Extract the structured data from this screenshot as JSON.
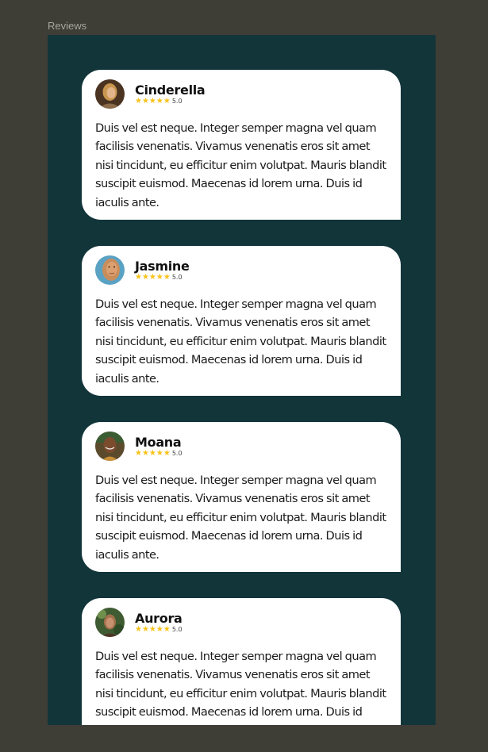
{
  "frame": {
    "label": "Reviews"
  },
  "reviews": [
    {
      "name": "Cinderella",
      "stars": "★★★★★",
      "rating": "5.0",
      "text": "Duis vel est neque. Integer semper magna vel quam facilisis venenatis. Vivamus venenatis eros sit amet nisi tincidunt, eu efficitur enim volutpat. Mauris blandit suscipit euismod. Maecenas id lorem urna. Duis id iaculis ante."
    },
    {
      "name": "Jasmine",
      "stars": "★★★★★",
      "rating": "5.0",
      "text": "Duis vel est neque. Integer semper magna vel quam facilisis venenatis. Vivamus venenatis eros sit amet nisi tincidunt, eu efficitur enim volutpat. Mauris blandit suscipit euismod. Maecenas id lorem urna. Duis id iaculis ante."
    },
    {
      "name": "Moana",
      "stars": "★★★★★",
      "rating": "5.0",
      "text": "Duis vel est neque. Integer semper magna vel quam facilisis venenatis. Vivamus venenatis eros sit amet nisi tincidunt, eu efficitur enim volutpat. Mauris blandit suscipit euismod. Maecenas id lorem urna. Duis id iaculis ante."
    },
    {
      "name": "Aurora",
      "stars": "★★★★★",
      "rating": "5.0",
      "text": "Duis vel est neque. Integer semper magna vel quam facilisis venenatis. Vivamus venenatis eros sit amet nisi tincidunt, eu efficitur enim volutpat. Mauris blandit suscipit euismod. Maecenas id lorem urna. Duis id iaculis ante."
    }
  ],
  "colors": {
    "canvas": "#3f3e36",
    "frame": "#12353a",
    "card": "#ffffff",
    "star": "#f7c21a"
  }
}
